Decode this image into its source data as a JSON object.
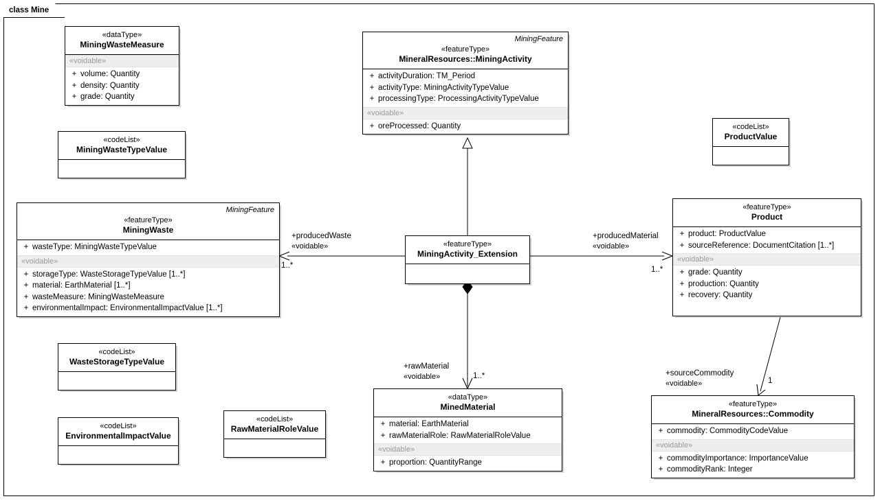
{
  "diagram": {
    "frame_label": "class Mine",
    "stereotypes": {
      "dataType": "«dataType»",
      "featureType": "«featureType»",
      "codeList": "«codeList»",
      "voidable": "«voidable»"
    },
    "namespace_label": "MiningFeature"
  },
  "nodes": {
    "miningWasteMeasure": {
      "stereotype": "«dataType»",
      "name": "MiningWasteMeasure",
      "voidable": "«voidable»",
      "attrs": [
        {
          "vis": "+",
          "text": "volume:  Quantity"
        },
        {
          "vis": "+",
          "text": "density:  Quantity"
        },
        {
          "vis": "+",
          "text": "grade:  Quantity"
        }
      ]
    },
    "miningWasteTypeValue": {
      "stereotype": "«codeList»",
      "name": "MiningWasteTypeValue"
    },
    "miningActivity": {
      "namespace": "MiningFeature",
      "stereotype": "«featureType»",
      "name": "MineralResources::MiningActivity",
      "attrs_top": [
        {
          "vis": "+",
          "text": "activityDuration:  TM_Period"
        },
        {
          "vis": "+",
          "text": "activityType:  MiningActivityTypeValue"
        },
        {
          "vis": "+",
          "text": "processingType:  ProcessingActivityTypeValue"
        }
      ],
      "voidable": "«voidable»",
      "attrs_voidable": [
        {
          "vis": "+",
          "text": "oreProcessed:  Quantity"
        }
      ]
    },
    "productValue": {
      "stereotype": "«codeList»",
      "name": "ProductValue"
    },
    "miningWaste": {
      "namespace": "MiningFeature",
      "stereotype": "«featureType»",
      "name": "MiningWaste",
      "attrs_top": [
        {
          "vis": "+",
          "text": "wasteType:  MiningWasteTypeValue"
        }
      ],
      "voidable": "«voidable»",
      "attrs_voidable": [
        {
          "vis": "+",
          "text": "storageType:  WasteStorageTypeValue [1..*]"
        },
        {
          "vis": "+",
          "text": "material:  EarthMaterial [1..*]"
        },
        {
          "vis": "+",
          "text": "wasteMeasure:  MiningWasteMeasure"
        },
        {
          "vis": "+",
          "text": "environmentalImpact:  EnvironmentalImpactValue [1..*]"
        }
      ]
    },
    "miningActivityExtension": {
      "stereotype": "«featureType»",
      "name": "MiningActivity_Extension"
    },
    "product": {
      "stereotype": "«featureType»",
      "name": "Product",
      "attrs_top": [
        {
          "vis": "+",
          "text": "product:  ProductValue"
        },
        {
          "vis": "+",
          "text": "sourceReference:  DocumentCitation [1..*]"
        }
      ],
      "voidable": "«voidable»",
      "attrs_voidable": [
        {
          "vis": "+",
          "text": "grade:  Quantity"
        },
        {
          "vis": "+",
          "text": "production:  Quantity"
        },
        {
          "vis": "+",
          "text": "recovery:  Quantity"
        }
      ]
    },
    "wasteStorageTypeValue": {
      "stereotype": "«codeList»",
      "name": "WasteStorageTypeValue"
    },
    "environmentalImpactValue": {
      "stereotype": "«codeList»",
      "name": "EnvironmentalImpactValue"
    },
    "rawMaterialRoleValue": {
      "stereotype": "«codeList»",
      "name": "RawMaterialRoleValue"
    },
    "minedMaterial": {
      "stereotype": "«dataType»",
      "name": "MinedMaterial",
      "attrs_top": [
        {
          "vis": "+",
          "text": "material:  EarthMaterial"
        },
        {
          "vis": "+",
          "text": "rawMaterialRole:  RawMaterialRoleValue"
        }
      ],
      "voidable": "«voidable»",
      "attrs_voidable": [
        {
          "vis": "+",
          "text": "proportion:  QuantityRange"
        }
      ]
    },
    "commodity": {
      "stereotype": "«featureType»",
      "name": "MineralResources::Commodity",
      "attrs_top": [
        {
          "vis": "+",
          "text": "commodity:  CommodityCodeValue"
        }
      ],
      "voidable": "«voidable»",
      "attrs_voidable": [
        {
          "vis": "+",
          "text": "commodityImportance:  ImportanceValue"
        },
        {
          "vis": "+",
          "text": "commodityRank:  Integer"
        }
      ]
    }
  },
  "connections": {
    "producedWaste": {
      "role": "+producedWaste",
      "stereotype": "«voidable»",
      "multiplicity": "1..*"
    },
    "producedMaterial": {
      "role": "+producedMaterial",
      "stereotype": "«voidable»",
      "multiplicity": "1..*"
    },
    "rawMaterial": {
      "role": "+rawMaterial",
      "stereotype": "«voidable»",
      "multiplicity": "1..*"
    },
    "sourceCommodity": {
      "role": "+sourceCommodity",
      "stereotype": "«voidable»",
      "multiplicity": "1"
    }
  }
}
